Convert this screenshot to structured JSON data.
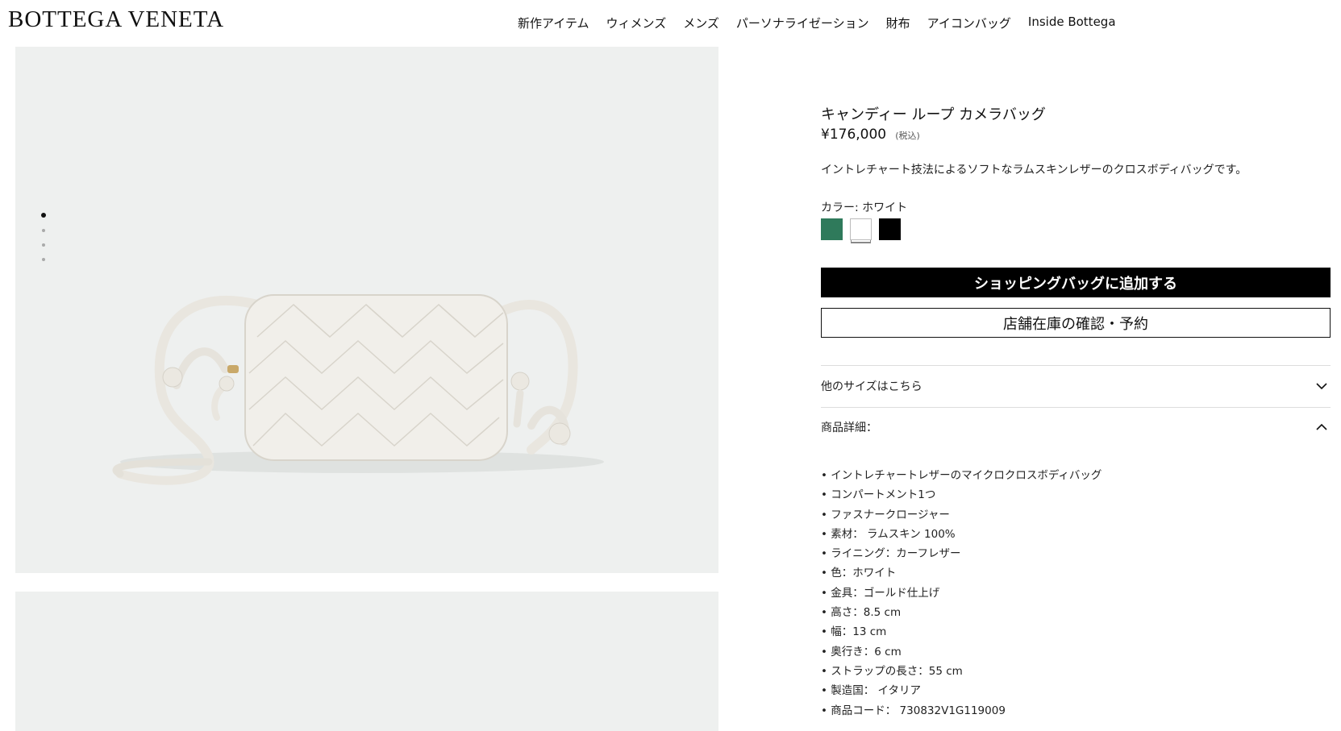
{
  "header": {
    "logo": "BOTTEGA VENETA",
    "nav": [
      "新作アイテム",
      "ウィメンズ",
      "メンズ",
      "パーソナライゼーション",
      "財布",
      "アイコンバッグ",
      "Inside Bottega"
    ]
  },
  "gallery": {
    "image_count": 4,
    "active_index": 0,
    "product_color": "#f1efea"
  },
  "product": {
    "title": "キャンディー ループ カメラバッグ",
    "price": "¥176,000",
    "tax_note": "(税込)",
    "description": "イントレチャート技法によるソフトなラムスキンレザーのクロスボディバッグです。",
    "color_label": "カラー: ホワイト",
    "swatches": [
      {
        "name": "green",
        "color": "#2f7a5b",
        "selected": false
      },
      {
        "name": "white",
        "color": "#ffffff",
        "selected": true
      },
      {
        "name": "black",
        "color": "#000000",
        "selected": false
      }
    ],
    "add_to_bag": "ショッピングバッグに追加する",
    "check_store": "店舗在庫の確認・予約",
    "other_sizes": "他のサイズはこちら",
    "details_heading": "商品詳細：",
    "details": [
      "イントレチャートレザーのマイクロクロスボディバッグ",
      "コンパートメント1つ",
      "ファスナークロージャー",
      "素材： ラムスキン 100%",
      "ライニング：カーフレザー",
      "色：ホワイト",
      "金具：ゴールド仕上げ",
      "高さ：8.5 cm",
      "幅：13 cm",
      "奥行き：6 cm",
      "ストラップの長さ：55 cm",
      "製造国： イタリア",
      "商品コード： 730832V1G119009"
    ]
  }
}
